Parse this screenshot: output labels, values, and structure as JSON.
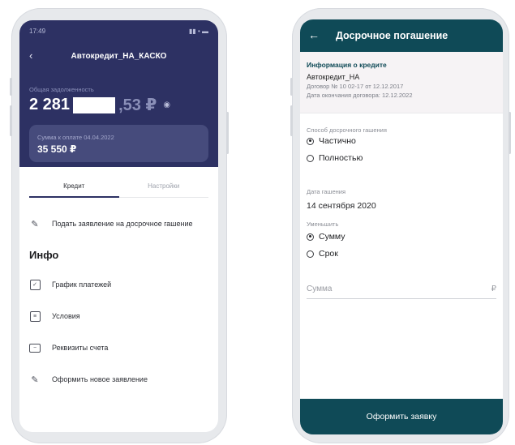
{
  "left": {
    "status_time": "17:49",
    "status_icons": "▮▮ • ▬",
    "title": "Автокредит_НА_КАСКО",
    "debt_label": "Общая задолженность",
    "debt_main": "2 281",
    "debt_cents": ",53 ₽",
    "due_label": "Сумма к оплате 04.04.2022",
    "due_amount": "35 550 ₽",
    "tabs": [
      "Кредит",
      "Настройки"
    ],
    "apply_early": "Подать заявление на досрочное гашение",
    "info_heading": "Инфо",
    "menu": [
      "График платежей",
      "Условия",
      "Реквизиты счета",
      "Оформить новое заявление"
    ]
  },
  "right": {
    "title": "Досрочное погашение",
    "credit_heading": "Информация о кредите",
    "credit_name": "Автокредит_НА",
    "contract": "Договор № 10      02-17 от 12.12.2017",
    "contract_end": "Дата окончания договора: 12.12.2022",
    "method_label": "Способ досрочного гашения",
    "method_options": [
      "Частично",
      "Полностью"
    ],
    "method_selected": "Частично",
    "date_label": "Дата гашения",
    "date_value": "14 сентября 2020",
    "reduce_label": "Уменьшить",
    "reduce_options": [
      "Сумму",
      "Срок"
    ],
    "reduce_selected": "Сумму",
    "sum_placeholder": "Сумма",
    "currency": "₽",
    "submit": "Оформить заявку"
  }
}
